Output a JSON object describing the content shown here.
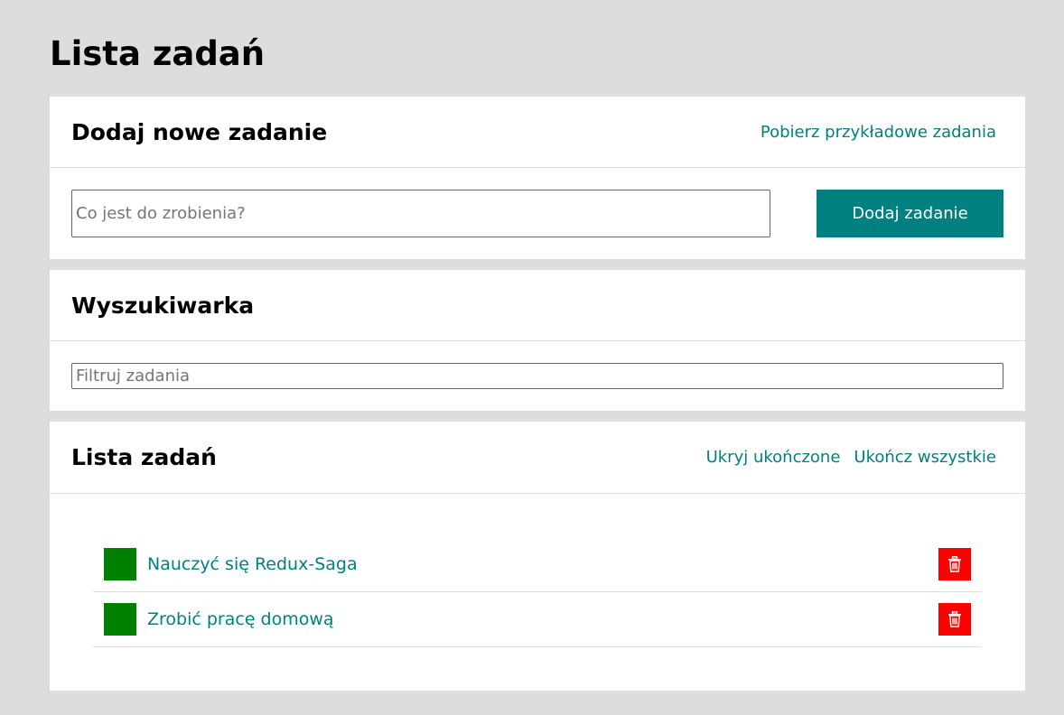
{
  "page": {
    "title": "Lista zadań"
  },
  "add_section": {
    "title": "Dodaj nowe zadanie",
    "fetch_button_label": "Pobierz przykładowe zadania",
    "input_placeholder": "Co jest do zrobienia?",
    "input_value": "",
    "submit_label": "Dodaj zadanie"
  },
  "search_section": {
    "title": "Wyszukiwarka",
    "filter_placeholder": "Filtruj zadania",
    "filter_value": ""
  },
  "list_section": {
    "title": "Lista zadań",
    "hide_done_label": "Ukryj ukończone",
    "complete_all_label": "Ukończ wszystkie",
    "tasks": [
      {
        "content": "Nauczyć się Redux-Saga",
        "toggle_color": "#008000",
        "remove_icon": "trash-icon"
      },
      {
        "content": "Zrobić pracę domową",
        "toggle_color": "#008000",
        "remove_icon": "trash-icon"
      }
    ]
  },
  "colors": {
    "accent": "#008080",
    "background": "#dddddd",
    "done_toggle": "#008000",
    "remove": "#ff0000"
  }
}
